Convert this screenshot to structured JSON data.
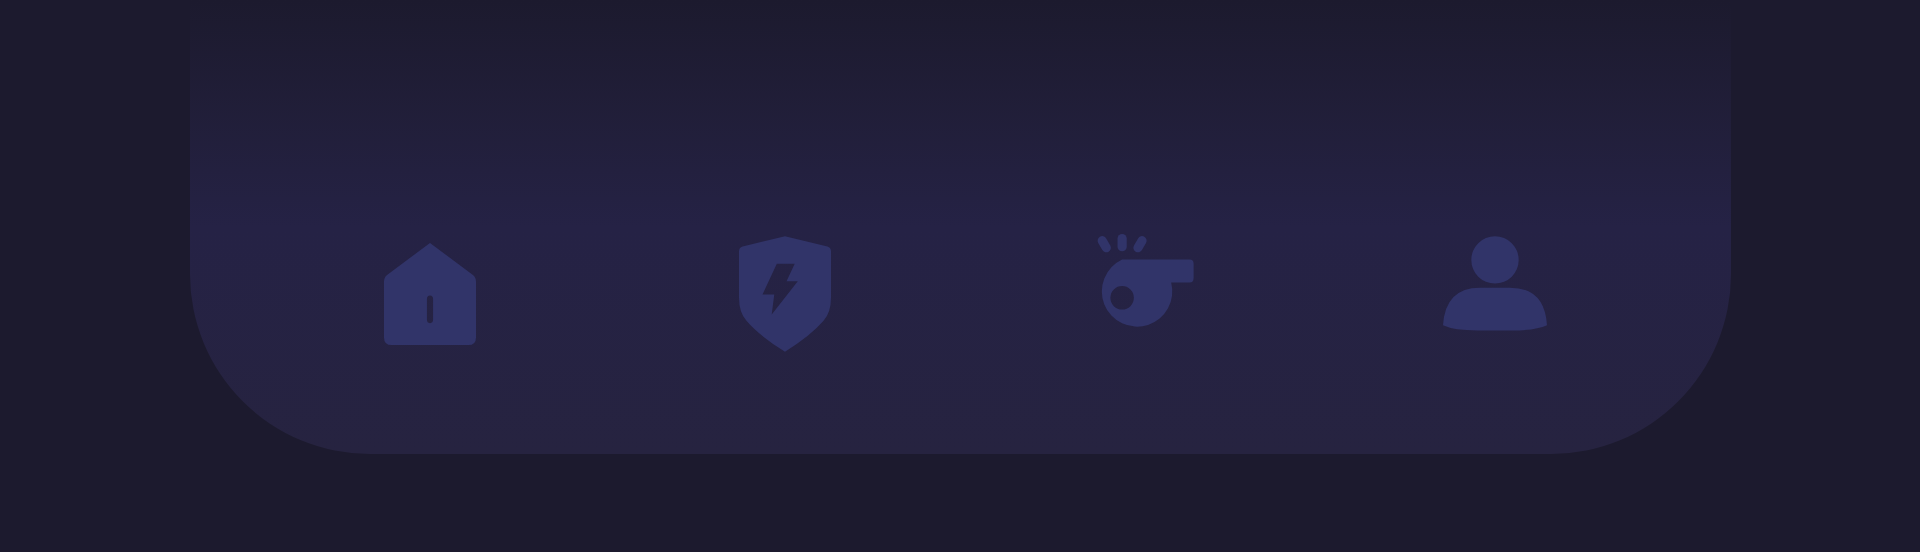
{
  "bottom_nav": {
    "items": [
      {
        "kind": "home"
      },
      {
        "kind": "shield"
      },
      {
        "kind": "whistle"
      },
      {
        "kind": "profile"
      }
    ]
  }
}
